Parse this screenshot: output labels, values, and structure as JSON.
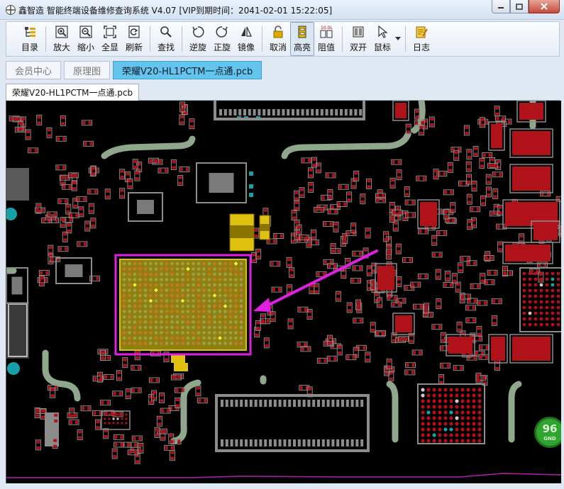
{
  "window": {
    "title": "鑫智造 智能终端设备维修查询系统 V4.07 [VIP到期时间：2041-02-01 15:22:05]"
  },
  "toolbar": {
    "buttons": [
      {
        "id": "catalog",
        "label": "目录",
        "icon": "catalog-icon"
      },
      {
        "id": "zoom-in",
        "label": "放大",
        "icon": "zoom-in-icon"
      },
      {
        "id": "zoom-out",
        "label": "缩小",
        "icon": "zoom-out-icon"
      },
      {
        "id": "fit-all",
        "label": "全显",
        "icon": "fit-all-icon"
      },
      {
        "id": "refresh",
        "label": "刷新",
        "icon": "refresh-icon"
      },
      {
        "id": "find",
        "label": "查找",
        "icon": "search-icon"
      },
      {
        "id": "rotate-ccw",
        "label": "逆旋",
        "icon": "rotate-ccw-icon"
      },
      {
        "id": "rotate-cw",
        "label": "正旋",
        "icon": "rotate-cw-icon"
      },
      {
        "id": "mirror",
        "label": "镜像",
        "icon": "mirror-icon"
      },
      {
        "id": "cancel",
        "label": "取消",
        "icon": "lock-icon"
      },
      {
        "id": "highlight",
        "label": "高亮",
        "icon": "highlight-icon"
      },
      {
        "id": "resistance",
        "label": "阻值",
        "icon": "resistance-icon"
      },
      {
        "id": "dual",
        "label": "双开",
        "icon": "dual-open-icon"
      },
      {
        "id": "mouse",
        "label": "鼠标",
        "icon": "cursor-icon"
      },
      {
        "id": "log",
        "label": "日志",
        "icon": "log-icon"
      }
    ],
    "active": "highlight"
  },
  "tabs_top": [
    {
      "label": "会员中心",
      "active": false
    },
    {
      "label": "原理图",
      "active": false
    },
    {
      "label": "荣耀V20-HL1PCTM一点通.pcb",
      "active": true
    }
  ],
  "tabs_doc": [
    {
      "label": "荣耀V20-HL1PCTM一点通.pcb"
    }
  ],
  "pcb": {
    "gnd_label": "96",
    "gnd_sub": "GND",
    "colors": {
      "board": "#000000",
      "pad_red": "#b0121a",
      "pad_grey": "#8c8c8c",
      "trace_green": "#8fa88c",
      "highlight": "#e020e0",
      "bga_yellow": "#b8a21c",
      "gnd_green": "#2fa52f"
    }
  }
}
